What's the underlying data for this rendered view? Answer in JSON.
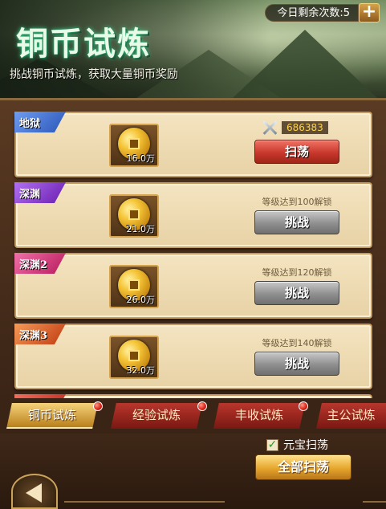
{
  "header": {
    "title": "铜币试炼",
    "subtitle": "挑战铜币试炼，获取大量铜币奖励",
    "daily_remaining": "今日剩余次数:5"
  },
  "trials": [
    {
      "name": "地狱",
      "ribbon_color": "#3a6fd8",
      "coin_amount": "16.0万",
      "score": "686383",
      "button": "扫荡",
      "button_style": "red"
    },
    {
      "name": "深渊",
      "ribbon_color": "#8a3ad0",
      "coin_amount": "21.0万",
      "lock_text": "等级达到100解锁",
      "button": "挑战",
      "button_style": "gray"
    },
    {
      "name": "深渊2",
      "ribbon_color": "#d8307a",
      "coin_amount": "26.0万",
      "lock_text": "等级达到120解锁",
      "button": "挑战",
      "button_style": "gray"
    },
    {
      "name": "深渊3",
      "ribbon_color": "#e05a24",
      "coin_amount": "32.0万",
      "lock_text": "等级达到140解锁",
      "button": "挑战",
      "button_style": "gray"
    }
  ],
  "tabs": [
    {
      "label": "铜币试炼",
      "active": true
    },
    {
      "label": "经验试炼",
      "active": false
    },
    {
      "label": "丰收试炼",
      "active": false
    },
    {
      "label": "主公试炼",
      "active": false
    }
  ],
  "footer": {
    "checkbox_label": "元宝扫荡",
    "checked": true,
    "sweep_all": "全部扫荡"
  }
}
